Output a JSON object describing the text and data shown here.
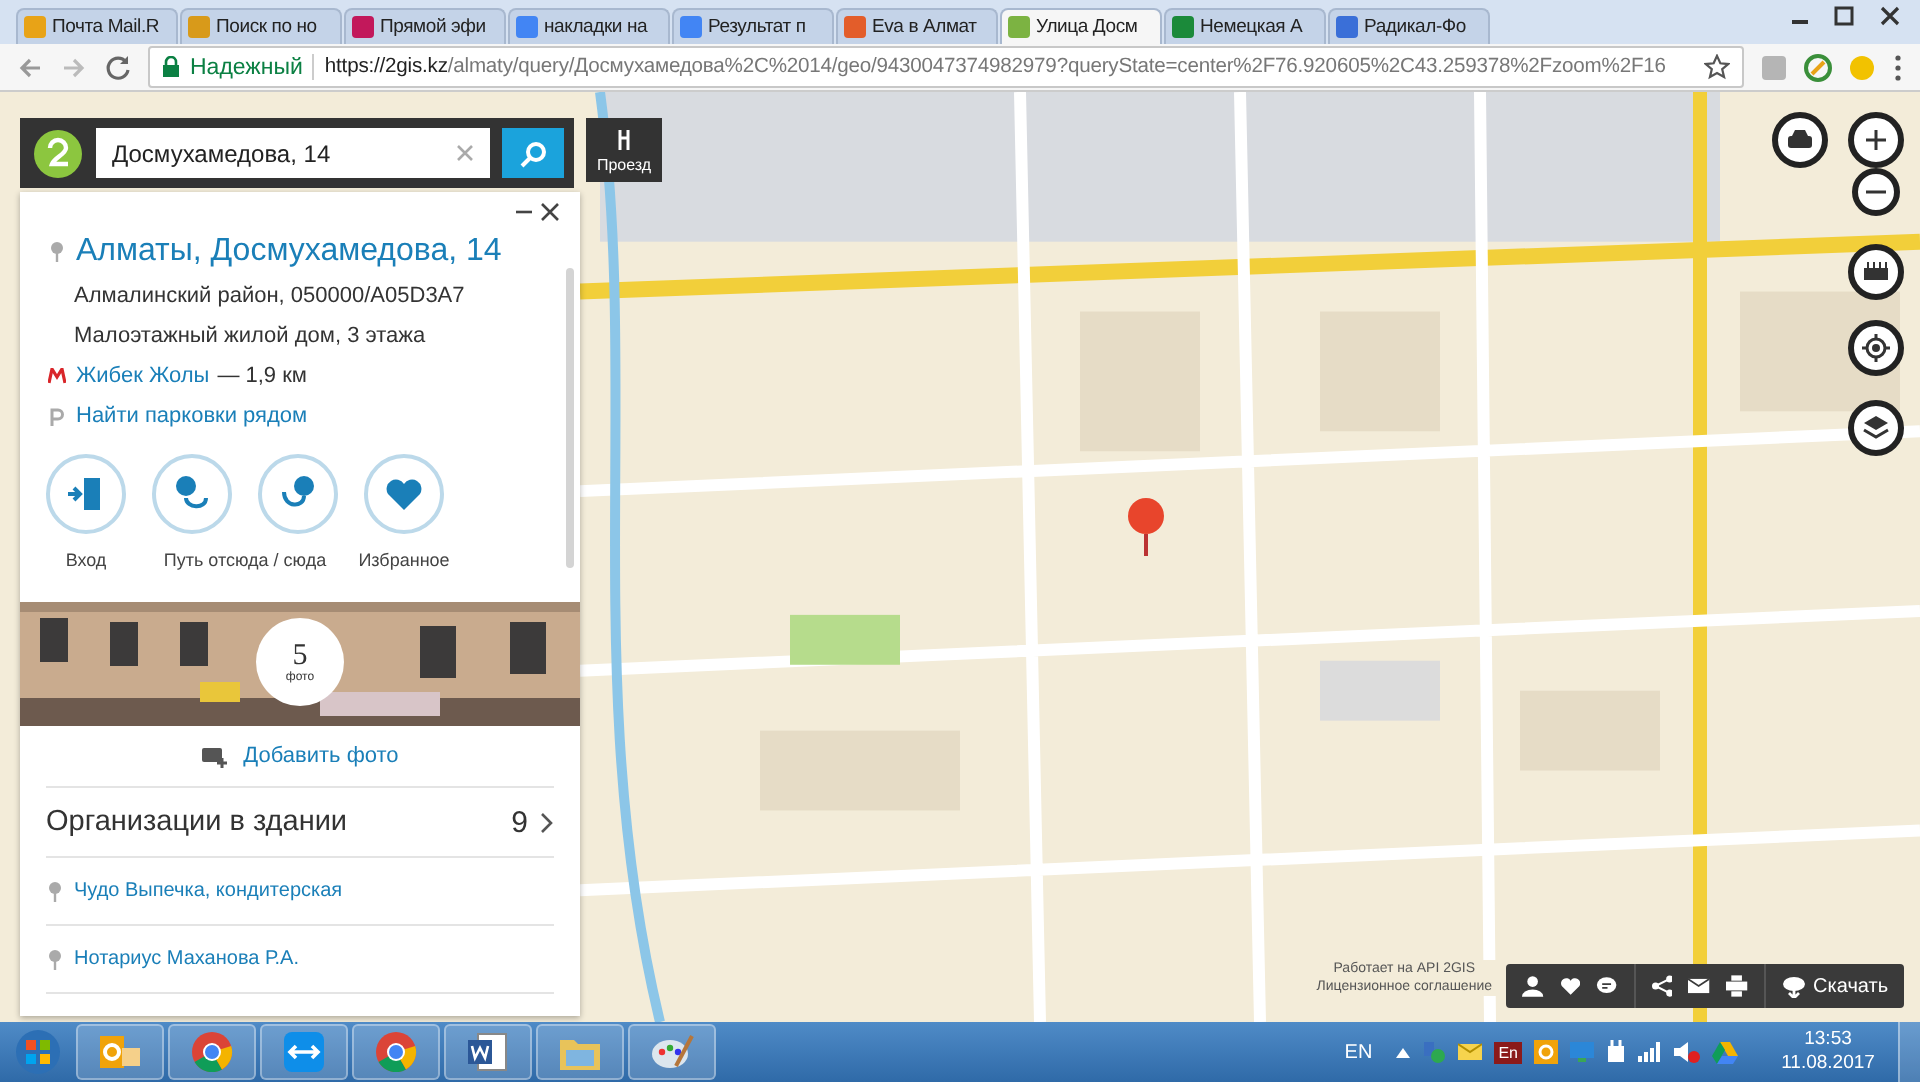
{
  "browser": {
    "tabs": [
      {
        "label": "Почта Mail.R",
        "color": "#e8a317",
        "selected": false
      },
      {
        "label": "Поиск по но",
        "color": "#d89a1a",
        "selected": false
      },
      {
        "label": "Прямой эфи",
        "color": "#c2185b",
        "selected": false
      },
      {
        "label": "накладки на",
        "color": "#4285f4",
        "selected": false
      },
      {
        "label": "Результат п",
        "color": "#4285f4",
        "selected": false
      },
      {
        "label": "Eva в Алмат",
        "color": "#e35d2a",
        "selected": false
      },
      {
        "label": "Улица Досм",
        "color": "#7cb342",
        "selected": true
      },
      {
        "label": "Немецкая А",
        "color": "#1b8a3a",
        "selected": false
      },
      {
        "label": "Радикал-Фо",
        "color": "#3a6fd8",
        "selected": false
      }
    ],
    "address": {
      "security": "Надежный",
      "url_host": "https://2gis.kz",
      "url_path": "/almaty/query/Досмухамедова%2C%2014/geo/9430047374982979?queryState=center%2F76.920605%2C43.259378%2Fzoom%2F16"
    }
  },
  "search": {
    "value": "Досмухамедова, 14",
    "route_button": "Проезд"
  },
  "place": {
    "title": "Алматы, Досмухамедова, 14",
    "district": "Алмалинский район, 050000/A05D3A7",
    "building": "Малоэтажный жилой дом, 3 этажа",
    "metro": {
      "station": "Жибек Жолы",
      "distance": "— 1,9 км"
    },
    "parking_link": "Найти парковки рядом",
    "actions": [
      {
        "kind": "entrance"
      },
      {
        "kind": "route-from"
      },
      {
        "kind": "route-to"
      },
      {
        "kind": "favorite"
      }
    ],
    "action_labels": [
      "Вход",
      "Путь отсюда / сюда",
      "Избранное"
    ],
    "photos": {
      "count": "5",
      "unit": "фото"
    },
    "add_photo": "Добавить фото",
    "organizations": {
      "label": "Организации в здании",
      "count": "9"
    },
    "org_list": [
      "Чудо Выпечка, кондитерская",
      "Нотариус Маханова Р.А."
    ]
  },
  "map_attribution": [
    "Работает на API 2GIS",
    "Лицензионное соглашение"
  ],
  "share_bar": {
    "download": "Скачать"
  },
  "taskbar": {
    "apps": [
      {
        "kind": "outlook"
      },
      {
        "kind": "chrome"
      },
      {
        "kind": "teamviewer"
      },
      {
        "kind": "chrome"
      },
      {
        "kind": "word"
      },
      {
        "kind": "explorer"
      },
      {
        "kind": "paint"
      }
    ],
    "language": "EN",
    "dictionary": "En",
    "time": "13:53",
    "date": "11.08.2017"
  }
}
